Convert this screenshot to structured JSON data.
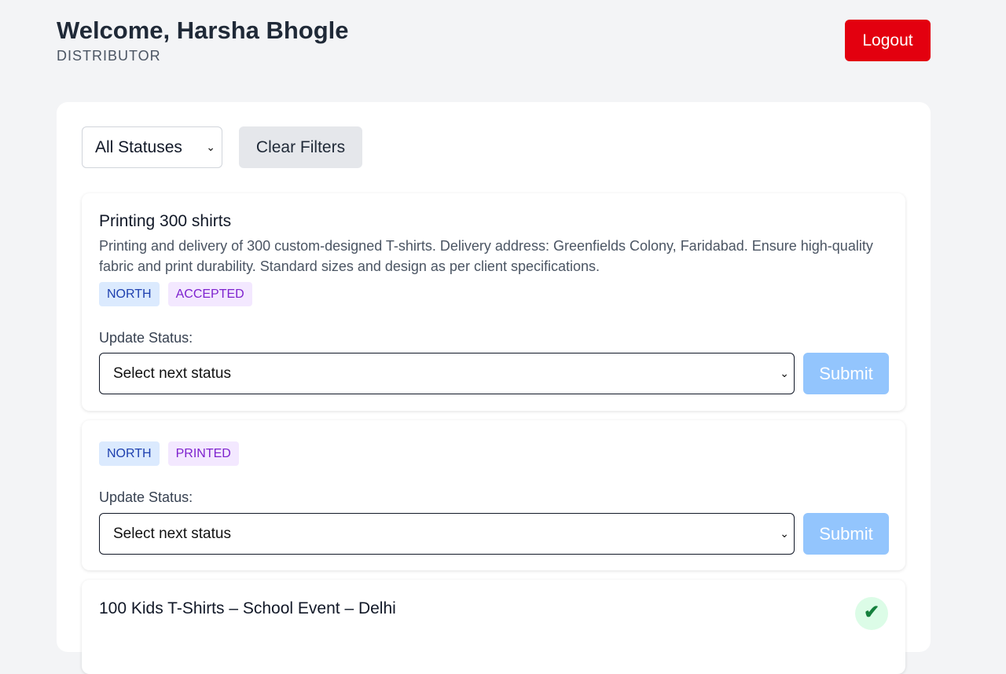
{
  "header": {
    "welcome": "Welcome, Harsha Bhogle",
    "role": "DISTRIBUTOR",
    "logout_label": "Logout"
  },
  "filters": {
    "status_selected": "All Statuses",
    "clear_label": "Clear Filters"
  },
  "orders": [
    {
      "title": "Printing 300 shirts",
      "description": "Printing and delivery of 300 custom-designed T-shirts. Delivery address: Greenfields Colony, Faridabad. Ensure high-quality fabric and print durability. Standard sizes and design as per client specifications.",
      "region": "NORTH",
      "status": "ACCEPTED",
      "update_label": "Update Status:",
      "next_status_placeholder": "Select next status",
      "submit_label": "Submit"
    },
    {
      "title": "",
      "description": "",
      "region": "NORTH",
      "status": "PRINTED",
      "update_label": "Update Status:",
      "next_status_placeholder": "Select next status",
      "submit_label": "Submit"
    },
    {
      "title": "100 Kids T-Shirts – School Event – Delhi",
      "completed_icon": "check-icon"
    }
  ],
  "colors": {
    "logout_bg": "#e3000f",
    "submit_disabled_bg": "#93c5fd",
    "region_tag_bg": "#dbeafe",
    "status_tag_bg": "#f3e8ff",
    "done_badge_bg": "#dcfce7"
  }
}
